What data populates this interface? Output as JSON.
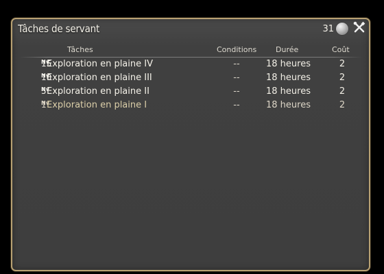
{
  "window": {
    "title": "Tâches de servant",
    "currency_count": "31",
    "currency_icon": "silver-coin-icon",
    "settings_icon": "crossed-tools-icon"
  },
  "table": {
    "headers": {
      "tasks": "Tâches",
      "conditions": "Conditions",
      "duration": "Durée",
      "cost": "Coût"
    },
    "rows": [
      {
        "level_prefix": "Nv",
        "level": "15",
        "name": "Exploration en plaine IV",
        "conditions": "--",
        "duration": "18 heures",
        "cost": "2"
      },
      {
        "level_prefix": "Nv",
        "level": "10",
        "name": "Exploration en plaine III",
        "conditions": "--",
        "duration": "18 heures",
        "cost": "2"
      },
      {
        "level_prefix": "Nv",
        "level": "5",
        "name": "Exploration en plaine II",
        "conditions": "--",
        "duration": "18 heures",
        "cost": "2"
      },
      {
        "level_prefix": "Nv",
        "level": "1",
        "name": "Exploration en plaine I",
        "conditions": "--",
        "duration": "18 heures",
        "cost": "2"
      }
    ]
  },
  "colors": {
    "window_border": "#b8a173",
    "window_background": "#404040",
    "text_primary": "#f5f2e9",
    "text_muted": "#d8d3c7"
  }
}
